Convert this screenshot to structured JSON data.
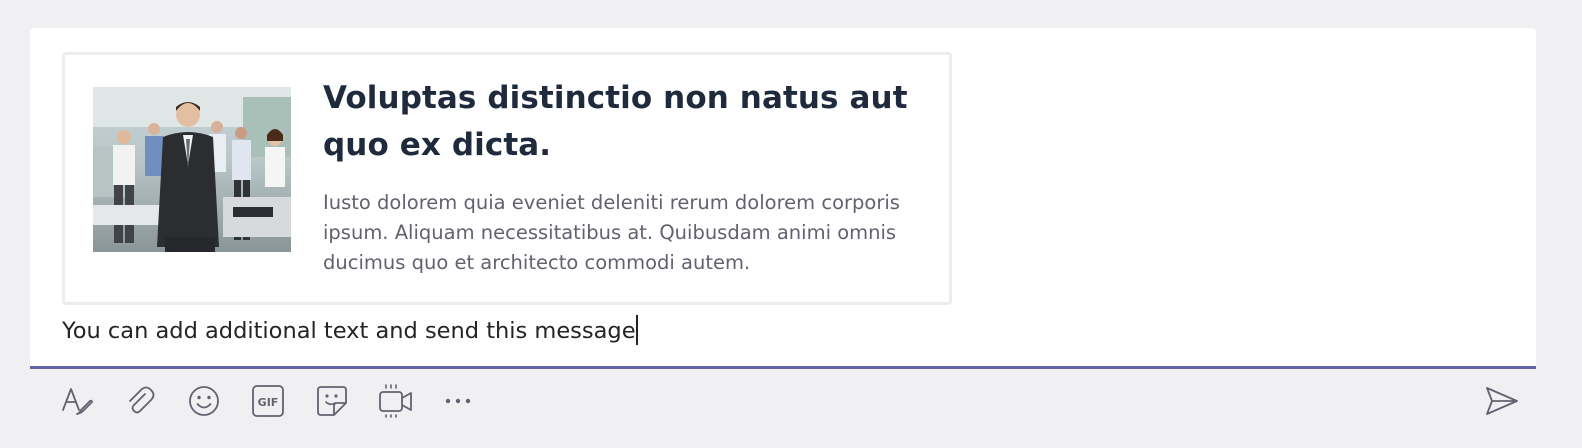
{
  "card": {
    "title": "Voluptas distinctio non natus aut quo ex dicta.",
    "body": "Iusto dolorem quia eveniet deleniti rerum dolorem corporis ipsum. Aliquam necessitatibus at. Quibusdam animi omnis ducimus quo et architecto commodi autem.",
    "image": "office-team-photo"
  },
  "message": {
    "text": "You can add additional text and send this message"
  },
  "toolbar": {
    "icons": [
      "format-icon",
      "attach-icon",
      "emoji-icon",
      "gif-icon",
      "sticker-icon",
      "meet-now-icon",
      "more-options-icon",
      "send-icon"
    ],
    "gif_label": "GIF"
  },
  "colors": {
    "accent": "#6264a7",
    "background": "#f0f0f3",
    "title": "#1f2a3d",
    "body": "#616270",
    "icon": "#616270"
  }
}
